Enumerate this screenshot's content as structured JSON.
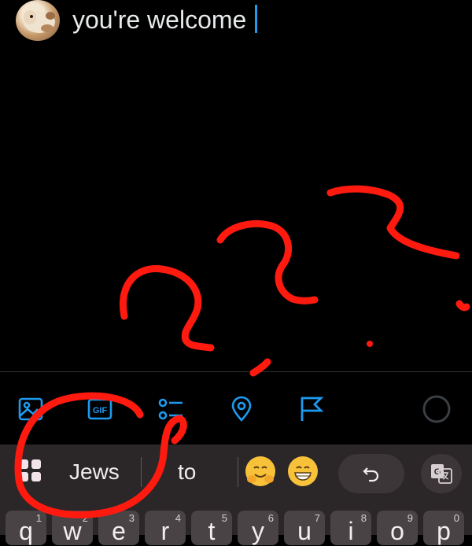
{
  "compose": {
    "text": "you're welcome"
  },
  "toolbar": {
    "icons": [
      "image-icon",
      "gif-icon",
      "poll-icon",
      "location-icon",
      "flag-icon",
      "progress-ring-icon"
    ],
    "gif_label": "GIF",
    "accent_color": "#1d9bf0"
  },
  "keyboard": {
    "suggestions": [
      "Jews",
      "to"
    ],
    "emojis": [
      "hugging-face-emoji",
      "grinning-face-emoji"
    ],
    "keys": [
      {
        "letter": "q",
        "number": "1"
      },
      {
        "letter": "w",
        "number": "2"
      },
      {
        "letter": "e",
        "number": "3"
      },
      {
        "letter": "r",
        "number": "4"
      },
      {
        "letter": "t",
        "number": "5"
      },
      {
        "letter": "y",
        "number": "6"
      },
      {
        "letter": "u",
        "number": "7"
      },
      {
        "letter": "i",
        "number": "8"
      },
      {
        "letter": "o",
        "number": "9"
      },
      {
        "letter": "p",
        "number": "0"
      }
    ]
  },
  "annotation_color": "#ff1a0f"
}
